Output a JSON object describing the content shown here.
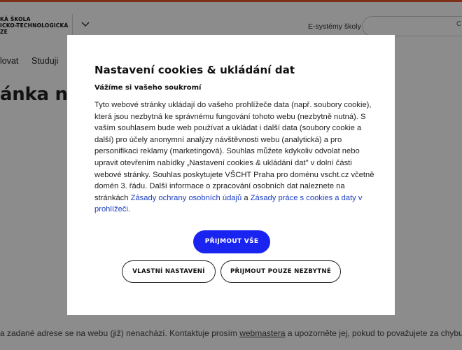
{
  "header": {
    "logo_lines": [
      "KÁ ŠKOLA",
      "ICKO-TECHNOLOGICKÁ",
      "ZE"
    ],
    "esystems_label": "E-systémy školy",
    "search_glyph": "C"
  },
  "nav": {
    "item_left": "lovat",
    "item_studuj": "Studuji"
  },
  "page": {
    "heading": "ánka ne",
    "error_prefix": "a zadané adrese se na webu (již) nenachází. Kontaktuje prosím ",
    "error_link": "webmastera",
    "error_suffix": " a upozorněte jej, pokud to považujete za chybu."
  },
  "modal": {
    "title": "Nastavení cookies & ukládání dat",
    "subtitle": "Vážíme si vašeho soukromí",
    "body_text": "Tyto webové stránky ukládají do vašeho prohlížeče data (např. soubory cookie), která jsou nezbytná ke správnému fungování tohoto webu (nezbytně nutná). S vaším souhlasem bude web používat a ukládat i další data (soubory cookie a další) pro účely anonymní analýzy návštěvnosti webu (analytická) a pro personifikaci reklamy (marketingová). Souhlas můžete kdykoliv odvolat nebo upravit otevřením nabídky „Nastavení cookies & ukládání dat\" v dolní části webové stránky. Souhlas poskytujete VŠCHT Praha pro doménu vscht.cz včetně domén 3. řádu. Další informace o zpracování osobních dat naleznete na stránkách ",
    "link_privacy": "Zásady ochrany osobních údajů",
    "joiner": " a ",
    "link_cookies": "Zásady práce s cookies a daty v prohlížeči",
    "end": ".",
    "accept_all_label": "PŘIJMOUT VŠE",
    "custom_label": "VLASTNÍ NASTAVENÍ",
    "necessary_label": "PŘIJMOUT POUZE NEZBYTNÉ"
  },
  "colors": {
    "accent_top_bar": "#e4572e",
    "primary_button": "#1a24f0",
    "link": "#1a3fc0"
  }
}
